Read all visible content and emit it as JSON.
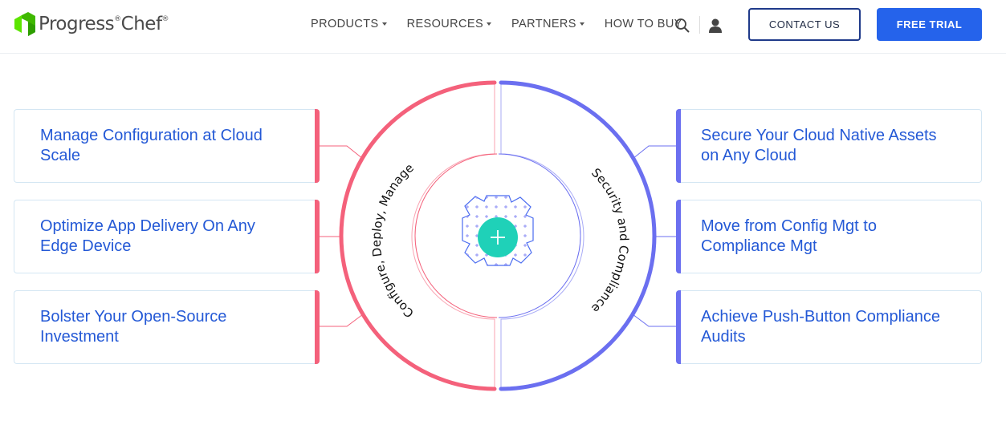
{
  "brand": {
    "name_progress": "Progress",
    "name_chef": "Chef",
    "mark": "®",
    "green": "#5ce500"
  },
  "nav": {
    "items": [
      {
        "label": "PRODUCTS",
        "dropdown": true
      },
      {
        "label": "RESOURCES",
        "dropdown": true
      },
      {
        "label": "PARTNERS",
        "dropdown": true
      },
      {
        "label": "HOW TO BUY",
        "dropdown": false
      }
    ],
    "search_icon": "search-icon",
    "user_icon": "user-icon",
    "contact_label": "CONTACT US",
    "trial_label": "FREE TRIAL"
  },
  "left_cards": [
    {
      "label": "Manage Configuration at Cloud Scale"
    },
    {
      "label": "Optimize App Delivery On Any Edge Device"
    },
    {
      "label": "Bolster Your Open-Source Investment"
    }
  ],
  "right_cards": [
    {
      "label": "Secure Your Cloud Native Assets on Any Cloud"
    },
    {
      "label": "Move from Config Mgt to Compliance Mgt"
    },
    {
      "label": "Achieve Push-Button Compliance Audits"
    }
  ],
  "diagram": {
    "left_arc_label": "Configure, Deploy, Manage",
    "right_arc_label": "Security and Compliance",
    "center_icon": "plus-icon",
    "colors": {
      "left": "#f4617b",
      "right": "#6b6ff0",
      "center": "#1fd1b8",
      "accent_blue": "#2563eb"
    }
  }
}
